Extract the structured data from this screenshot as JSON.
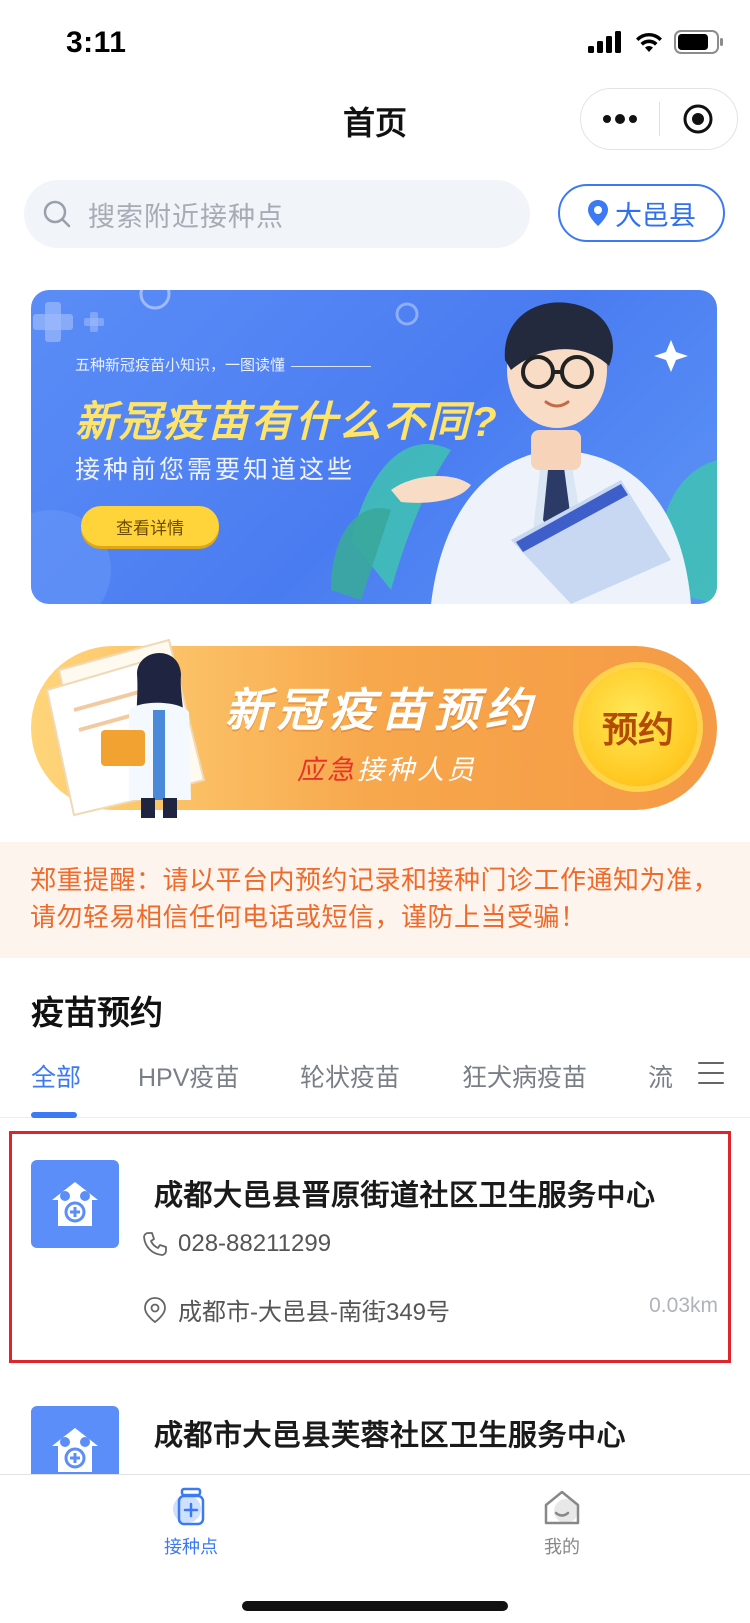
{
  "status": {
    "time": "3:11"
  },
  "nav": {
    "title": "首页",
    "more_icon": "more-dots-icon",
    "close_icon": "target-circle-icon"
  },
  "search": {
    "placeholder": "搜索附近接种点",
    "location": "大邑县"
  },
  "banner1": {
    "small_text": "五种新冠疫苗小知识，一图读懂",
    "title": "新冠疫苗有什么不同?",
    "subtitle": "接种前您需要知道这些",
    "button": "查看详情"
  },
  "banner2": {
    "title": "新冠疫苗预约",
    "sub_red": "应急",
    "sub_rest": "接种人员",
    "button": "预约"
  },
  "notice": {
    "text": "郑重提醒：请以平台内预约记录和接种门诊工作通知为准，请勿轻易相信任何电话或短信，谨防上当受骗！"
  },
  "section": {
    "title": "疫苗预约"
  },
  "tabs": [
    {
      "label": "全部"
    },
    {
      "label": "HPV疫苗"
    },
    {
      "label": "轮状疫苗"
    },
    {
      "label": "狂犬病疫苗"
    },
    {
      "label": "流"
    }
  ],
  "sites": [
    {
      "name": "成都大邑县晋原街道社区卫生服务中心",
      "phone": "028-88211299",
      "address": "成都市-大邑县-南街349号",
      "distance": "0.03km"
    },
    {
      "name": "成都市大邑县芙蓉社区卫生服务中心"
    }
  ],
  "tabbar": [
    {
      "label": "接种点",
      "icon": "vaccine-bottle-icon",
      "active": true
    },
    {
      "label": "我的",
      "icon": "home-smile-icon",
      "active": false
    }
  ],
  "colors": {
    "accent": "#3c7af5",
    "notice": "#f06a2a",
    "highlight": "#e0242c"
  }
}
